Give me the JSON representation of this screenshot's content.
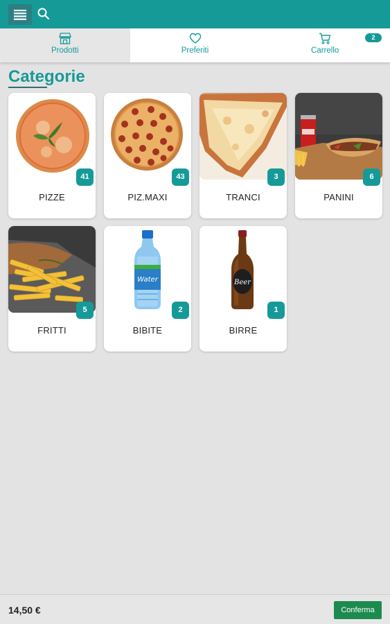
{
  "header": {
    "menu_icon": "hamburger-menu-icon",
    "search_icon": "search-icon",
    "color": "#169a98"
  },
  "tabs": [
    {
      "label": "Prodotti",
      "icon": "store-icon",
      "active": true
    },
    {
      "label": "Preferiti",
      "icon": "heart-icon",
      "active": false
    },
    {
      "label": "Carrello",
      "icon": "cart-icon",
      "active": false,
      "badge": "2"
    }
  ],
  "section": {
    "title": "Categorie"
  },
  "categories": [
    {
      "name": "PIZZE",
      "count": "41"
    },
    {
      "name": "PIZ.MAXI",
      "count": "43"
    },
    {
      "name": "TRANCI",
      "count": "3"
    },
    {
      "name": "PANINI",
      "count": "6"
    },
    {
      "name": "FRITTI",
      "count": "5"
    },
    {
      "name": "BIBITE",
      "count": "2"
    },
    {
      "name": "BIRRE",
      "count": "1"
    }
  ],
  "footer": {
    "total": "14,50 €",
    "confirm_label": "Conferma",
    "confirm_color": "#1d8b4f"
  }
}
